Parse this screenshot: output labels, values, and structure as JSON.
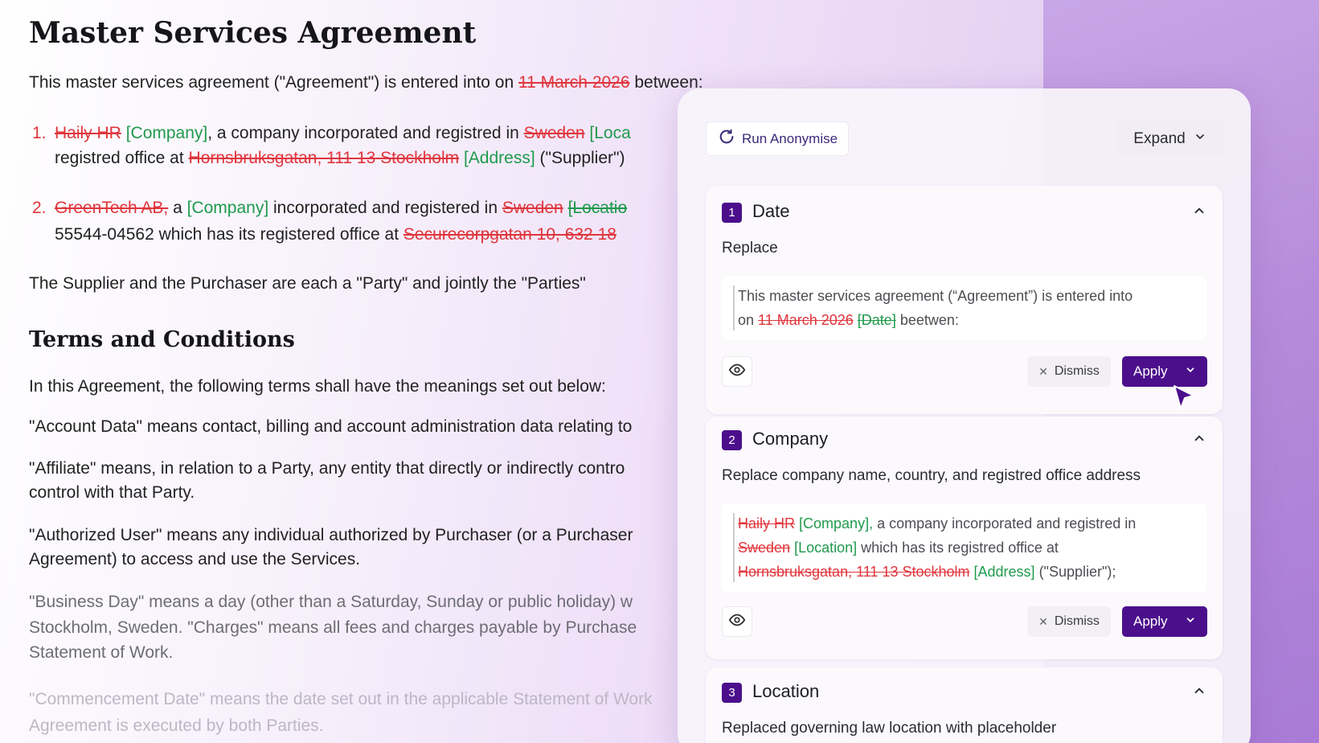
{
  "document": {
    "title": "Master Services Agreement",
    "intro": {
      "before": "This master services agreement (\"Agreement\") is entered into on ",
      "date": "11 March 2026",
      "after": " between:"
    },
    "item1": {
      "num": "1.",
      "name": "Haily HR",
      "tag_company": "[Company]",
      "text1": ", a company incorporated and registred in ",
      "country": "Sweden",
      "tag_location": "[Loca",
      "line2_before": "registred office at ",
      "address": "Hornsbruksgatan, 111 13 Stockholm",
      "tag_address": "[Address]",
      "line2_after": " (\"Supplier\")"
    },
    "item2": {
      "num": "2.",
      "name": "GreenTech AB,",
      "text0": " a ",
      "tag_company": "[Company]",
      "text1": " incorporated and registered in ",
      "country": "Sweden",
      "tag_location": "[Locatio",
      "line2_before": "55544-04562 which has its registered office at ",
      "address": "Securecorpgatan 10, 632 18"
    },
    "parties": "The Supplier and the Purchaser are each a \"Party\" and jointly the \"Parties\"",
    "terms_heading": "Terms and Conditions",
    "terms_intro": "In this Agreement, the following terms shall have the meanings set out below:",
    "def_account": "\"Account Data\" means contact, billing and account administration data relating to",
    "def_affiliate_1": "\"Affiliate\" means, in relation to a Party, any entity that directly or indirectly contro",
    "def_affiliate_2": "control with that Party.",
    "def_user_1": "\"Authorized User\" means any individual authorized by Purchaser (or a Purchaser",
    "def_user_2": "Agreement) to access and use the Services.",
    "def_business_1": "\"Business Day\" means a day (other than a Saturday, Sunday or public holiday) w",
    "def_business_2": "Stockholm, Sweden. \"Charges\" means all fees and charges payable by Purchase",
    "def_business_3": "Statement of Work.",
    "def_commence_1": "\"Commencement Date\" means the date set out in the applicable Statement of Work",
    "def_commence_2": "Agreement is executed by both Parties."
  },
  "panel": {
    "run_label": "Run Anonymise",
    "expand_label": "Expand",
    "cards": [
      {
        "number": "1",
        "title": "Date",
        "subtitle": "Replace",
        "quote": {
          "line1": "This master services agreement (“Agreement”) is entered into",
          "line2_before": "on ",
          "strike": "11 March 2026",
          "tag": "[Date]",
          "line2_after": " beetwen:"
        },
        "dismiss_label": "Dismiss",
        "apply_label": "Apply"
      },
      {
        "number": "2",
        "title": "Company",
        "subtitle": "Replace company name, country, and registred office address",
        "quote": {
          "strike1": "Haily HR",
          "tag1": "[Company],",
          "text1": " a company incorporated and registred in",
          "strike2": "Sweden",
          "tag2": "[Location]",
          "text2": " which has its registred office at",
          "strike3": "Hornsbruksgatan, 111 13 Stockholm",
          "tag3": "[Address]",
          "text3": " (\"Supplier\");"
        },
        "dismiss_label": "Dismiss",
        "apply_label": "Apply"
      },
      {
        "number": "3",
        "title": "Location",
        "subtitle": "Replaced governing law location with placeholder"
      }
    ]
  },
  "colors": {
    "accent": "#4b0f8c",
    "removed": "#e0353c",
    "added": "#1f9a4c"
  }
}
